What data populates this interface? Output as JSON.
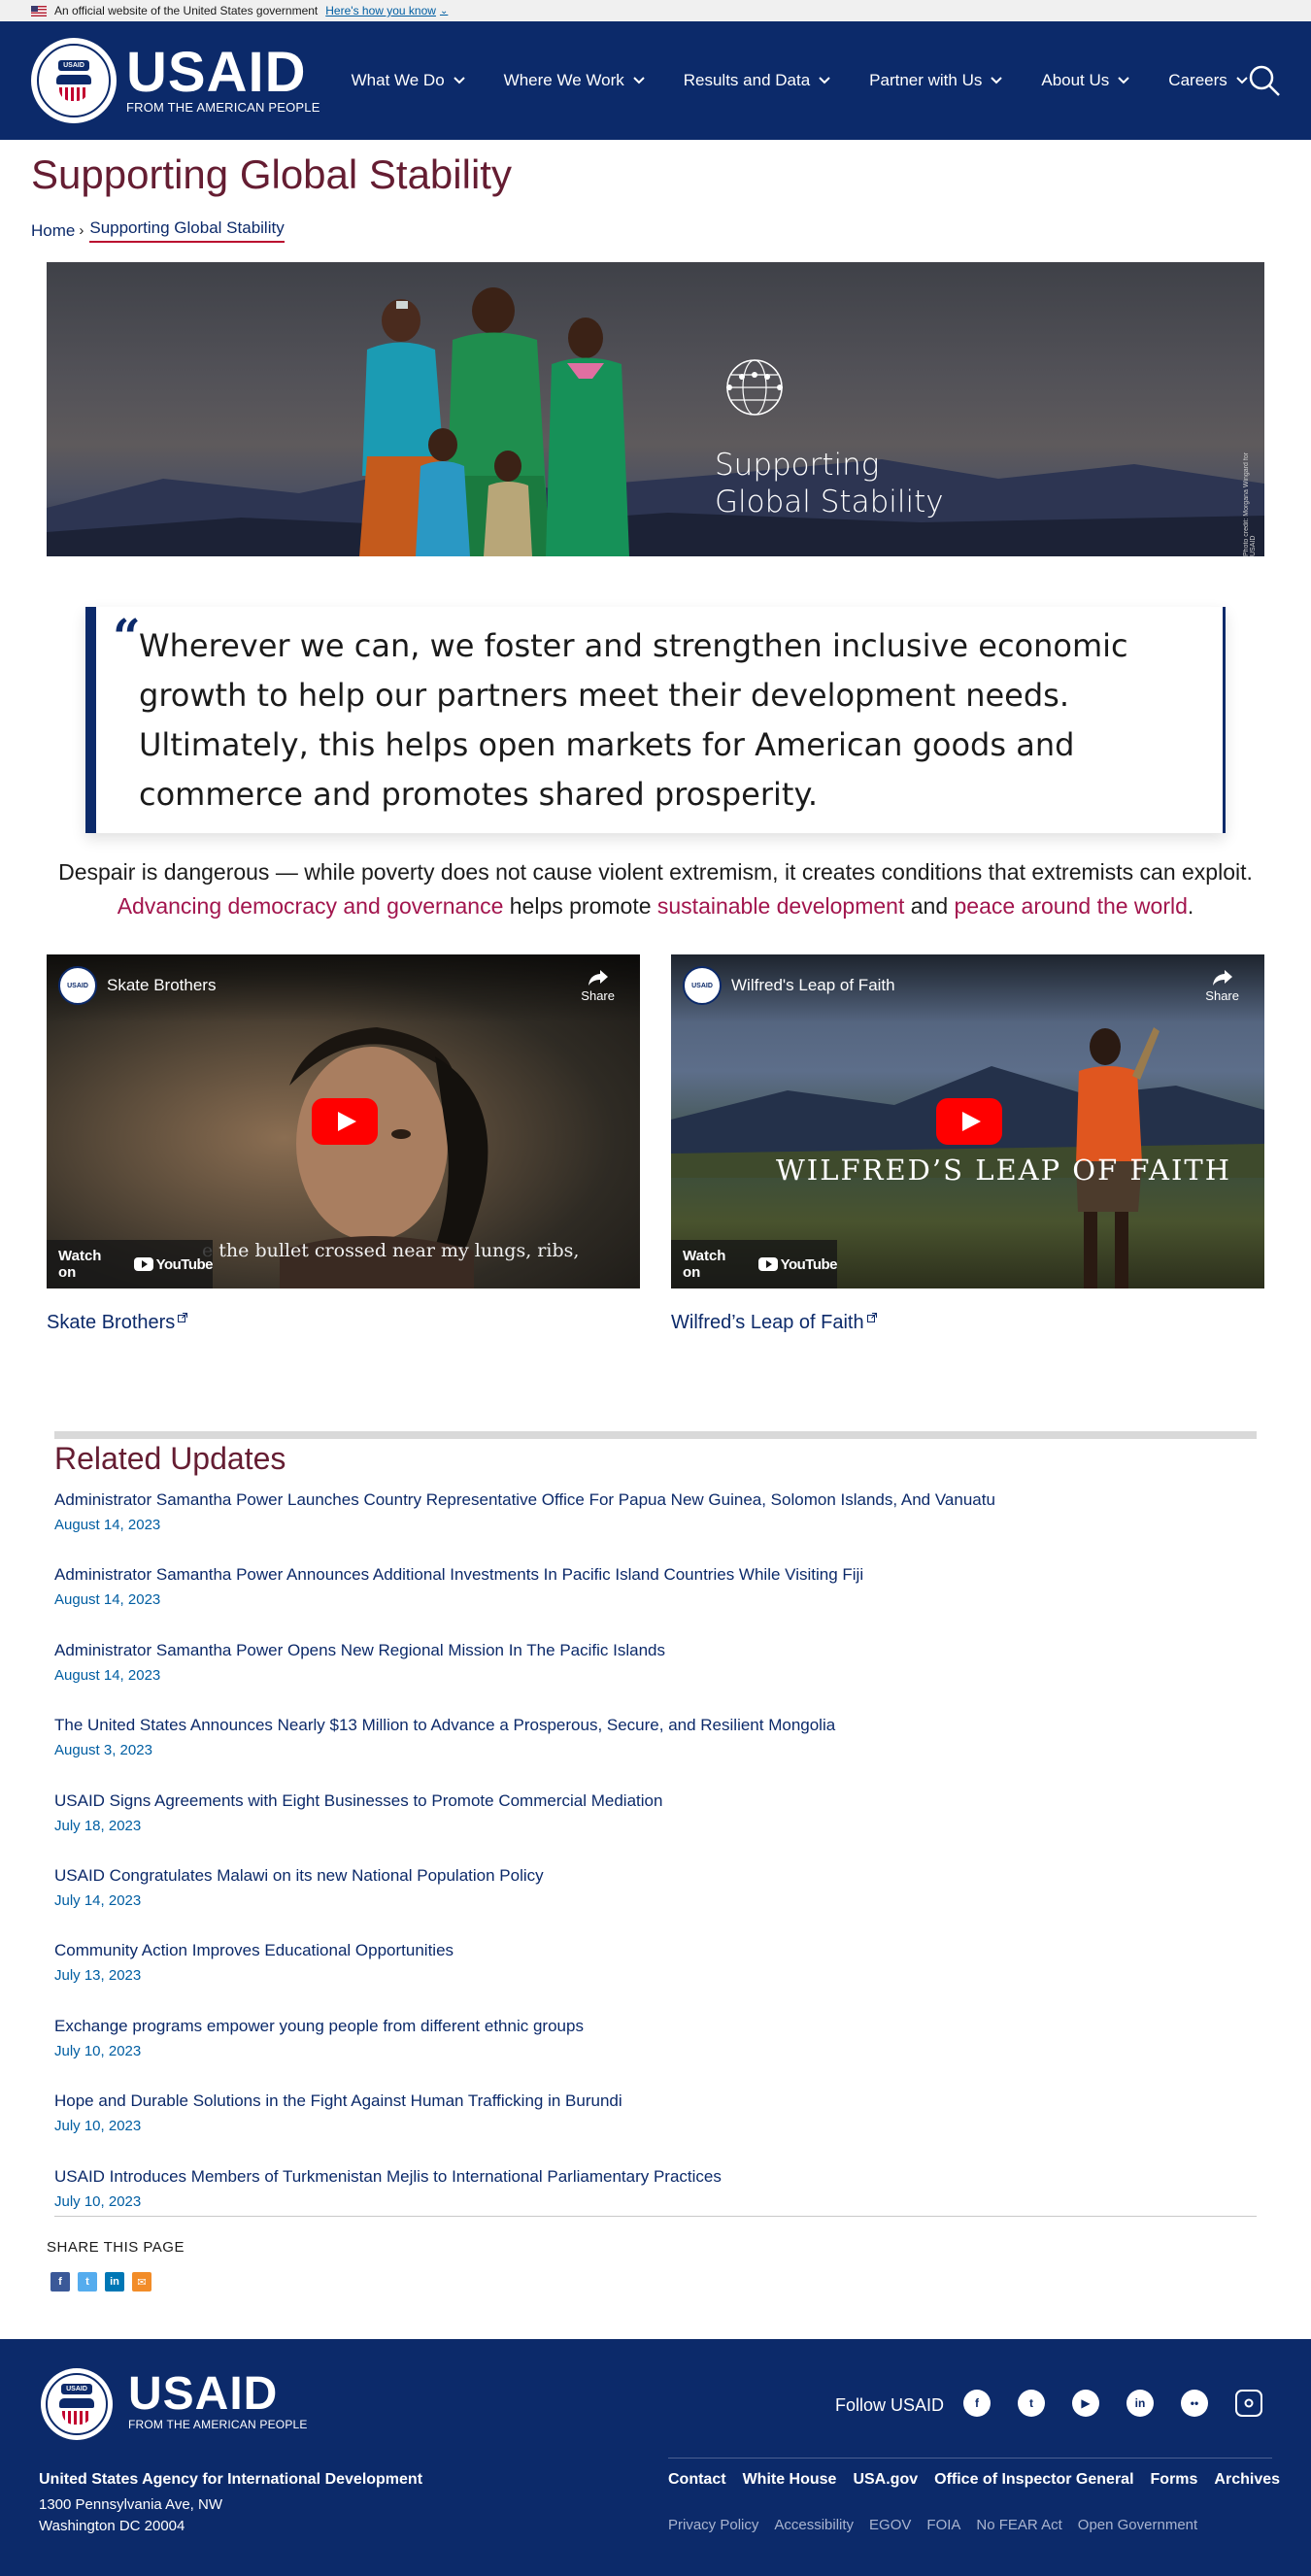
{
  "gov_banner": {
    "text": "An official website of the United States government",
    "link": "Here's how you know"
  },
  "header": {
    "logo_word": "USAID",
    "logo_tagline": "FROM THE AMERICAN PEOPLE",
    "seal_text": "USAID",
    "nav": [
      "What We Do",
      "Where We Work",
      "Results and Data",
      "Partner with Us",
      "About Us",
      "Careers"
    ]
  },
  "page": {
    "title": "Supporting Global Stability",
    "breadcrumb": {
      "home": "Home",
      "separator": "›",
      "current": "Supporting Global Stability"
    }
  },
  "hero": {
    "caption_line1": "Supporting",
    "caption_line2": "Global Stability",
    "credit": "Photo credit: Morgana Wingard for USAID"
  },
  "quote": {
    "mark": "“",
    "text": "Wherever we can, we foster and strengthen inclusive economic growth to help our partners meet their development needs. Ultimately, this helps open markets for American goods and commerce and promotes shared prosperity."
  },
  "intro": {
    "text_before": "Despair is dangerous — while poverty does not cause violent extremism, it creates conditions that extremists can exploit. ",
    "link1": "Advancing democracy and governance",
    "text_mid1": " helps promote ",
    "link2": "sustainable development",
    "text_mid2": " and ",
    "link3": "peace around the world",
    "text_end": "."
  },
  "videos": [
    {
      "title": "Skate Brothers",
      "share": "Share",
      "watch_on": "Watch on",
      "youtube": "YouTube",
      "subtitle": "e the bullet crossed near my lungs, ribs,",
      "link": "Skate Brothers"
    },
    {
      "title": "Wilfred's Leap of Faith",
      "share": "Share",
      "watch_on": "Watch on",
      "youtube": "YouTube",
      "overlay_title": "WILFRED’S LEAP OF FAITH",
      "link": "Wilfred’s Leap of Faith"
    }
  ],
  "related": {
    "title": "Related Updates",
    "items": [
      {
        "title": "Administrator Samantha Power Launches Country Representative Office For Papua New Guinea, Solomon Islands, And Vanuatu",
        "date": "August 14, 2023"
      },
      {
        "title": "Administrator Samantha Power Announces Additional Investments In Pacific Island Countries While Visiting Fiji",
        "date": "August 14, 2023"
      },
      {
        "title": "Administrator Samantha Power Opens New Regional Mission In The Pacific Islands",
        "date": "August 14, 2023"
      },
      {
        "title": "The United States Announces Nearly $13 Million to Advance a Prosperous, Secure, and Resilient Mongolia",
        "date": "August 3, 2023"
      },
      {
        "title": "USAID Signs Agreements with Eight Businesses to Promote Commercial Mediation",
        "date": "July 18, 2023"
      },
      {
        "title": "USAID Congratulates Malawi on its new National Population Policy",
        "date": "July 14, 2023"
      },
      {
        "title": "Community Action Improves Educational Opportunities",
        "date": "July 13, 2023"
      },
      {
        "title": "Exchange programs empower young people from different ethnic groups",
        "date": "July 10, 2023"
      },
      {
        "title": "Hope and Durable Solutions in the Fight Against Human Trafficking in Burundi",
        "date": "July 10, 2023"
      },
      {
        "title": "USAID Introduces Members of Turkmenistan Mejlis to International Parliamentary Practices",
        "date": "July 10, 2023"
      }
    ]
  },
  "share": {
    "label": "SHARE THIS PAGE",
    "icons": [
      {
        "name": "facebook-icon",
        "glyph": "f",
        "color": "#3b5998"
      },
      {
        "name": "twitter-icon",
        "glyph": "t",
        "color": "#55acee"
      },
      {
        "name": "linkedin-icon",
        "glyph": "in",
        "color": "#0077b5"
      },
      {
        "name": "email-icon",
        "glyph": "✉",
        "color": "#f28c28"
      }
    ]
  },
  "footer": {
    "logo_word": "USAID",
    "logo_tagline": "FROM THE AMERICAN PEOPLE",
    "follow": "Follow USAID",
    "socials": [
      {
        "name": "facebook-icon",
        "glyph": "f"
      },
      {
        "name": "twitter-icon",
        "glyph": "t"
      },
      {
        "name": "youtube-icon",
        "glyph": "▶"
      },
      {
        "name": "linkedin-icon",
        "glyph": "in"
      },
      {
        "name": "flickr-icon",
        "glyph": "••"
      },
      {
        "name": "instagram-icon",
        "glyph": "◎"
      }
    ],
    "org": "United States Agency for International Development",
    "address": [
      "1300 Pennsylvania Ave, NW",
      "Washington DC 20004"
    ],
    "primary_links": [
      "Contact",
      "White House",
      "USA.gov",
      "Office of Inspector General",
      "Forms",
      "Archives"
    ],
    "secondary_links": [
      "Privacy Policy",
      "Accessibility",
      "EGOV",
      "FOIA",
      "No FEAR Act",
      "Open Government"
    ]
  },
  "colors": {
    "navy": "#0c2a6a",
    "title_maroon": "#651d32",
    "link_crimson": "#a2154d",
    "date_blue": "#005ea2"
  }
}
